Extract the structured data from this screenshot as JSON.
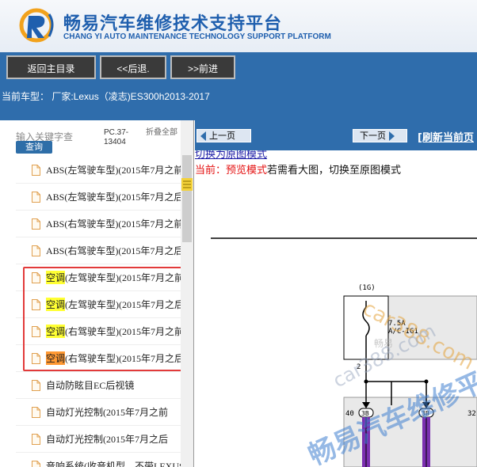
{
  "header": {
    "title": "畅易汽车维修技术支持平台",
    "subtitle": "CHANG YI AUTO MAINTENANCE TECHNOLOGY SUPPORT PLATFORM"
  },
  "nav": {
    "back_main": "返回主目录",
    "back": "<<后退.",
    "forward": ">>前进"
  },
  "car": {
    "current": "当前车型：  厂家:Lexus（凌志)ES300h2013-2017"
  },
  "sidebar": {
    "search_placeholder": "输入关键字查",
    "search_button": "查询",
    "pc_code": "PC.37-13404",
    "fold_all": "折叠全部",
    "items": [
      {
        "hl": "",
        "text": "ABS(左驾驶车型)(2015年7月之前"
      },
      {
        "hl": "",
        "text": "ABS(左驾驶车型)(2015年7月之后"
      },
      {
        "hl": "",
        "text": "ABS(右驾驶车型)(2015年7月之前"
      },
      {
        "hl": "",
        "text": "ABS(右驾驶车型)(2015年7月之后"
      },
      {
        "hl": "空调",
        "text": "(左驾驶车型)(2015年7月之前"
      },
      {
        "hl": "空调",
        "text": "(左驾驶车型)(2015年7月之后"
      },
      {
        "hl": "空调",
        "text": "(右驾驶车型)(2015年7月之前"
      },
      {
        "hl": "空调",
        "text": "(右驾驶车型)(2015年7月之后"
      },
      {
        "hl": "",
        "text": "自动防眩目EC后视镜"
      },
      {
        "hl": "",
        "text": "自动灯光控制(2015年7月之前"
      },
      {
        "hl": "",
        "text": "自动灯光控制(2015年7月之后"
      },
      {
        "hl": "",
        "text": "音响系统(收音机型，不带LEXUS"
      }
    ]
  },
  "viewer": {
    "prev_page": "上一页",
    "next_page": "下一页",
    "refresh": "[刷新当前页",
    "switch_link": "切换为原图模式",
    "mode_prefix": "当前：预览模式",
    "mode_suffix": "若需看大图，切换至原图模式"
  },
  "diagram": {
    "connector_id": "(1G)",
    "fuse_amp": "7.5A",
    "fuse_name": "A/C-IG1",
    "pin_top": "2",
    "pin_left": "40",
    "pin_right": "32",
    "conn_code": "3B",
    "watermark1": "car388.com",
    "watermark2": "car388.com",
    "watermark3": "畅易汽车维修平台",
    "watermark_small": "畅易"
  },
  "colors": {
    "nav_blue": "#2f6dac",
    "brand_blue": "#1f5fae",
    "highlight_yellow": "#ffff33",
    "highlight_orange": "#ff9933",
    "red_box": "#e23a3a",
    "wire_purple": "#7b2fb0"
  }
}
